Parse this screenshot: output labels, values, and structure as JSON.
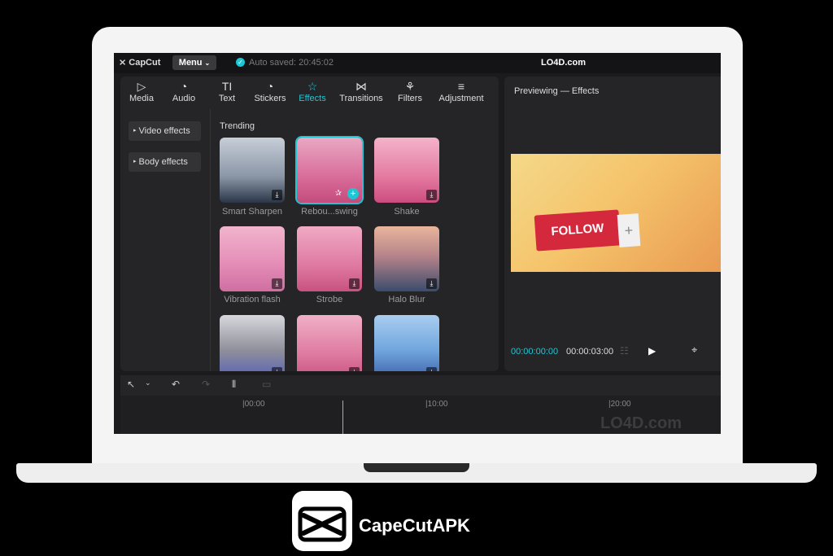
{
  "app": {
    "logo_text": "CapCut",
    "menu_label": "Menu",
    "autosave_text": "Auto saved: 20:45:02",
    "site_label": "LO4D.com"
  },
  "toolbar": [
    {
      "label": "Media",
      "icon": "media-icon"
    },
    {
      "label": "Audio",
      "icon": "audio-icon"
    },
    {
      "label": "Text",
      "icon": "text-icon"
    },
    {
      "label": "Stickers",
      "icon": "stickers-icon"
    },
    {
      "label": "Effects",
      "icon": "effects-icon",
      "active": true
    },
    {
      "label": "Transitions",
      "icon": "transitions-icon"
    },
    {
      "label": "Filters",
      "icon": "filters-icon"
    },
    {
      "label": "Adjustment",
      "icon": "adjustment-icon"
    }
  ],
  "sidebar": {
    "items": [
      {
        "label": "Video effects"
      },
      {
        "label": "Body effects"
      }
    ]
  },
  "effects": {
    "section_title": "Trending",
    "items": [
      {
        "label": "Smart Sharpen"
      },
      {
        "label": "Rebou...swing"
      },
      {
        "label": "Shake"
      },
      {
        "label": "Vibration flash"
      },
      {
        "label": "Strobe"
      },
      {
        "label": "Halo Blur"
      }
    ]
  },
  "preview": {
    "title": "Previewing — Effects",
    "overlay_text": "FOLLOW",
    "overlay_plus": "+",
    "current_time": "00:00:00:00",
    "duration": "00:00:03:00"
  },
  "timeline": {
    "ticks": [
      "|00:00",
      "|10:00",
      "|20:00"
    ],
    "watermark": "LO4D.com"
  },
  "brand": {
    "name": "CapeCutAPK"
  },
  "colors": {
    "accent": "#1ec6d3",
    "follow_button": "#d4283d"
  }
}
